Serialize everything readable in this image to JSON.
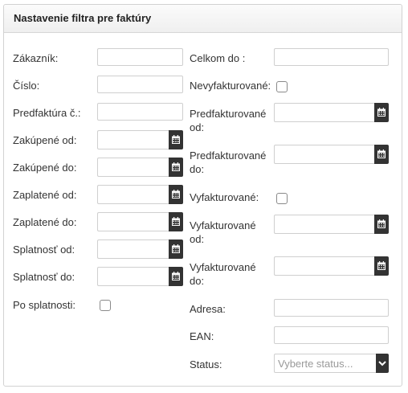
{
  "panel": {
    "title": "Nastavenie filtra pre faktúry"
  },
  "left": {
    "customer_label": "Zákazník:",
    "number_label": "Číslo:",
    "proforma_label": "Predfaktúra č.:",
    "bought_from_label": "Zakúpené od:",
    "bought_to_label": "Zakúpené do:",
    "paid_from_label": "Zaplatené od:",
    "paid_to_label": "Zaplatené do:",
    "due_from_label": "Splatnosť od:",
    "due_to_label": "Splatnosť do:",
    "overdue_label": "Po splatnosti:"
  },
  "right": {
    "total_to_label": "Celkom do :",
    "uninvoiced_label": "Nevyfakturované:",
    "preinvoiced_from_label_1": "Predfakturované",
    "preinvoiced_from_label_2": "od:",
    "preinvoiced_to_label_1": "Predfakturované",
    "preinvoiced_to_label_2": "do:",
    "invoiced_label": "Vyfakturované:",
    "invoiced_from_label_1": "Vyfakturované",
    "invoiced_from_label_2": "od:",
    "invoiced_to_label_1": "Vyfakturované",
    "invoiced_to_label_2": "do:",
    "address_label": "Adresa:",
    "ean_label": "EAN:",
    "status_label": "Status:",
    "status_placeholder": "Vyberte status..."
  },
  "icons": {
    "calendar": "calendar-icon",
    "chevron": "chevron-down-icon"
  },
  "colors": {
    "button_bg": "#333333",
    "border": "#cfcfcf",
    "header_bg": "#f2f2f2"
  }
}
